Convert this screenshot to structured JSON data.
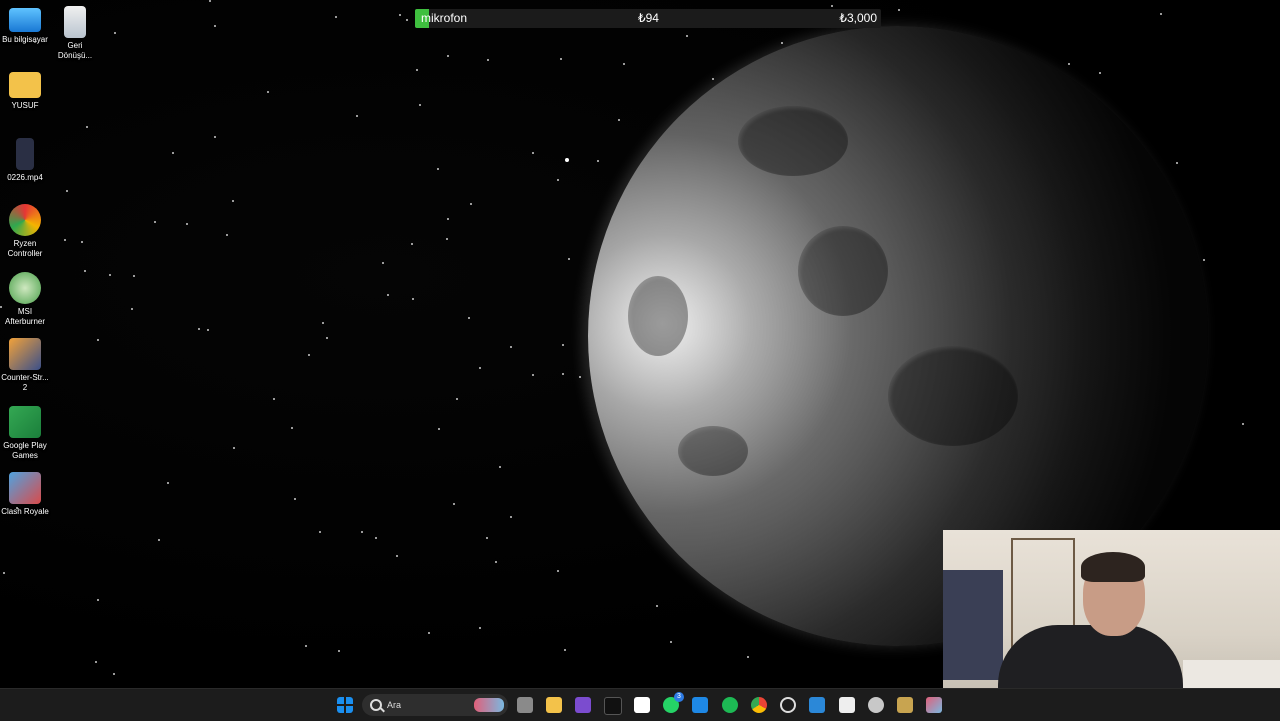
{
  "overlay": {
    "label": "mikrofon",
    "current": "₺94",
    "goal": "₺3,000",
    "progress": 0.031
  },
  "desktop_icons": [
    {
      "label": "Bu bilgisayar",
      "icon": "computer-icon"
    },
    {
      "label": "Geri Dönüşü...",
      "icon": "recycle-bin-icon"
    },
    {
      "label": "YUSUF",
      "icon": "folder-icon"
    },
    {
      "label": "0226.mp4",
      "icon": "video-file-icon"
    },
    {
      "label": "Ryzen Controller",
      "icon": "ryzen-controller-icon"
    },
    {
      "label": "MSI Afterburner",
      "icon": "msi-afterburner-icon"
    },
    {
      "label": "Counter-Str... 2",
      "icon": "counter-strike-icon"
    },
    {
      "label": "Google Play Games",
      "icon": "google-play-games-icon"
    },
    {
      "label": "Clash Royale",
      "icon": "clash-royale-icon"
    }
  ],
  "taskbar": {
    "search_placeholder": "Ara",
    "apps": [
      "windows-start-icon",
      "task-view-icon",
      "file-explorer-icon",
      "visual-studio-icon",
      "apple-tv-icon",
      "notion-icon",
      "whatsapp-icon",
      "vscode-icon",
      "spotify-icon",
      "chrome-icon",
      "chatgpt-icon",
      "todo-icon",
      "unity-icon",
      "steam-icon",
      "league-of-legends-icon",
      "active-app-icon"
    ],
    "whatsapp_badge": "3"
  },
  "colors": {
    "progress_fill": "#3fbf3f",
    "taskbar_bg": "#1c1c1c",
    "desktop_bg": "#000000"
  }
}
